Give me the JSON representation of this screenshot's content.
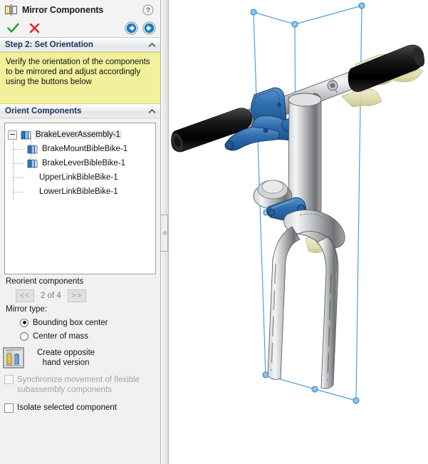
{
  "window": {
    "title": "Mirror Components",
    "title_icon": "mirror-components-icon",
    "help_icon": "help-icon",
    "ok_icon": "green-check-icon",
    "cancel_icon": "red-x-icon",
    "back_icon": "back-arrow-icon",
    "forward_icon": "forward-arrow-icon"
  },
  "step_section": {
    "header": "Step 2: Set Orientation",
    "collapse_icon": "chevron-up-icon",
    "message": "Verify the orientation of the components to be mirrored and adjust accordingly using the buttons below"
  },
  "orient_section": {
    "header": "Orient Components",
    "collapse_icon": "chevron-up-icon",
    "tree": [
      {
        "label": "BrakeLeverAssembly-1",
        "depth": 0,
        "expanded": true,
        "selected": true,
        "icon": "mirrored-component-icon"
      },
      {
        "label": "BrakeMountBibleBike-1",
        "depth": 1,
        "expanded": false,
        "selected": false,
        "icon": "mirrored-component-icon"
      },
      {
        "label": "BrakeLeverBibleBike-1",
        "depth": 1,
        "expanded": false,
        "selected": false,
        "icon": "mirrored-component-icon"
      },
      {
        "label": "UpperLinkBibleBike-1",
        "depth": 0,
        "expanded": false,
        "selected": false,
        "icon": "none"
      },
      {
        "label": "LowerLinkBibleBike-1",
        "depth": 0,
        "expanded": false,
        "selected": false,
        "icon": "none"
      }
    ]
  },
  "reorient": {
    "label": "Reorient components",
    "prev_label": "<<",
    "next_label": ">>",
    "counter": "2 of 4",
    "prev_enabled": false,
    "next_enabled": false
  },
  "mirror_type": {
    "label": "Mirror type:",
    "options": [
      {
        "label": "Bounding box center",
        "selected": true
      },
      {
        "label": "Center of mass",
        "selected": false
      }
    ]
  },
  "opposite_hand": {
    "icon": "create-opposite-hand-version-icon",
    "line1": "Create opposite",
    "line2": "hand version"
  },
  "checkboxes": [
    {
      "label": "Synchronize movement of flexible subassembly components",
      "checked": false,
      "enabled": false
    },
    {
      "label": "Isolate selected component",
      "checked": false,
      "enabled": true
    }
  ],
  "splitter": {
    "handle_icon": "panel-splitter-handle-icon"
  },
  "viewport": {
    "model_name": "bicycle-handlebar-brake-lever-assembly",
    "selection_box_color": "#4a9fe0",
    "highlight_color": "#2f6fb0",
    "ghost_preview_color": "#ded8a6",
    "grip_color": "#111111",
    "metal_color": "#9a9a9a"
  }
}
